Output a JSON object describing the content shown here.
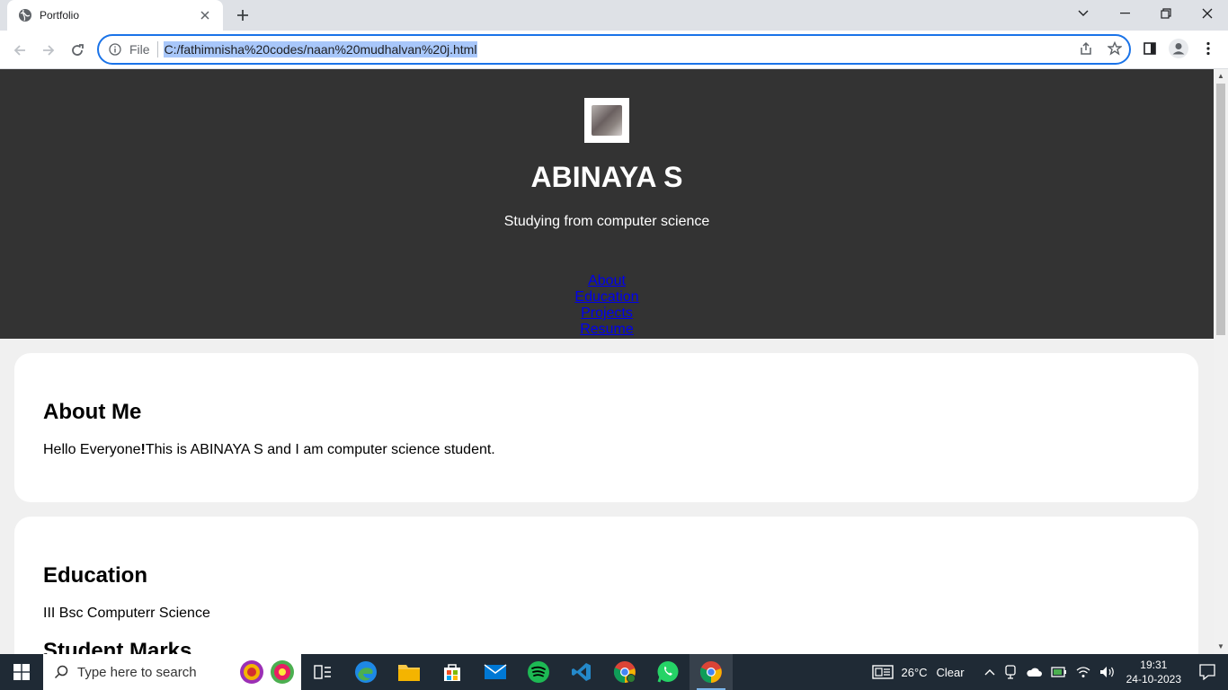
{
  "browser": {
    "tab_title": "Portfolio",
    "omnibox_scheme": "File",
    "url": "C:/fathimnisha%20codes/naan%20mudhalvan%20j.html"
  },
  "page": {
    "name": "ABINAYA S",
    "subtitle": "Studying from computer science",
    "nav": [
      "About",
      "Education",
      "Projects",
      "Resume"
    ],
    "about": {
      "heading": "About Me",
      "text_prefix": "Hello Everyone",
      "text_bang": "!",
      "text_suffix": "This is ABINAYA S and I am computer science student."
    },
    "education": {
      "heading": "Education",
      "degree": "III Bsc Computerr Science",
      "marks_heading": "Student Marks"
    }
  },
  "taskbar": {
    "search_placeholder": "Type here to search",
    "weather_temp": "26°C",
    "weather_text": "Clear",
    "time": "19:31",
    "date": "24-10-2023"
  },
  "colors": {
    "hero_bg": "#333333",
    "link": "#0000ee",
    "accent": "#1a73e8"
  }
}
